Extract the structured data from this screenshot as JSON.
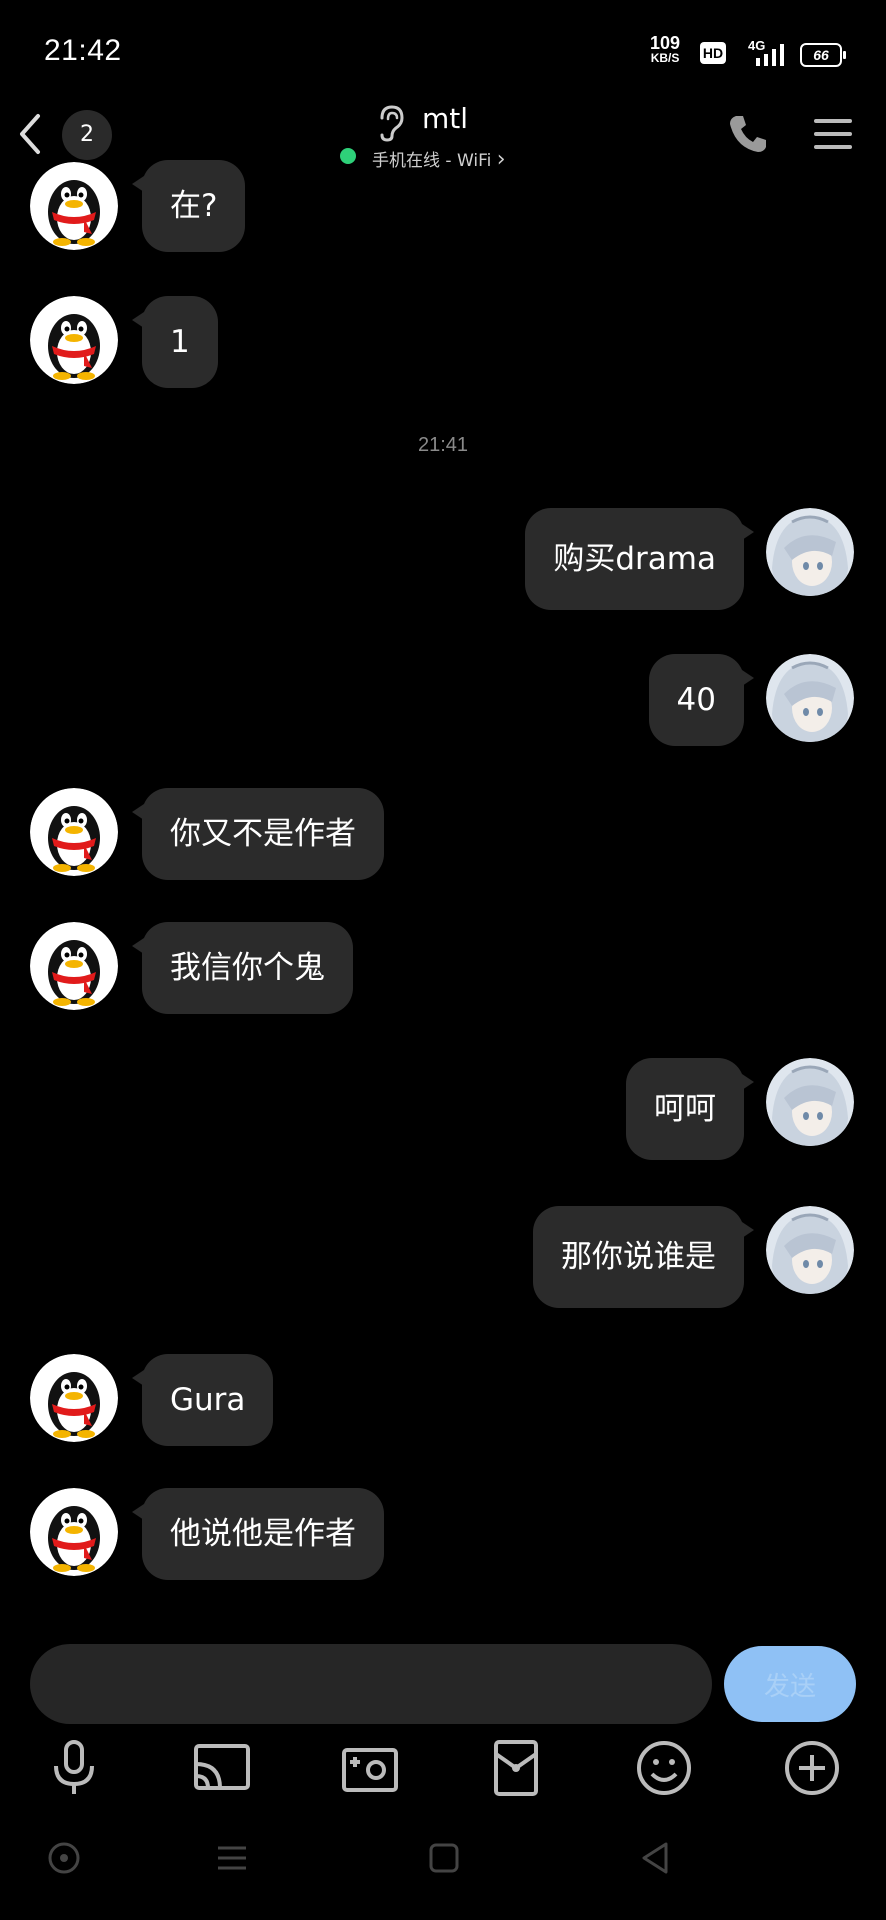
{
  "status_bar": {
    "time": "21:42",
    "net_speed_value": "109",
    "net_speed_unit": "KB/S",
    "hd_label": "HD",
    "net_type": "4G",
    "battery": "66"
  },
  "header": {
    "unread_count": "2",
    "contact_name": "mtl",
    "online_status": "手机在线 - WiFi",
    "chevron": "›"
  },
  "timestamp": "21:41",
  "messages": [
    {
      "side": "left",
      "text": "在?"
    },
    {
      "side": "left",
      "text": "1"
    },
    {
      "side": "right",
      "text": "购买drama"
    },
    {
      "side": "right",
      "text": "40"
    },
    {
      "side": "left",
      "text": "你又不是作者"
    },
    {
      "side": "left",
      "text": "我信你个鬼"
    },
    {
      "side": "right",
      "text": "呵呵"
    },
    {
      "side": "right",
      "text": "那你说谁是"
    },
    {
      "side": "left",
      "text": "Gura"
    },
    {
      "side": "left",
      "text": "他说他是作者"
    }
  ],
  "composer": {
    "placeholder": "",
    "send_label": "发送"
  },
  "toolbar": [
    "mic-icon",
    "cast-icon",
    "camera-icon",
    "red-packet-icon",
    "emoji-icon",
    "plus-icon"
  ],
  "nav": [
    "home-circle-icon",
    "menu-lines-icon",
    "square-icon",
    "back-triangle-icon"
  ],
  "colors": {
    "background": "#000000",
    "bubble": "#2b2b2b",
    "online": "#2ed079",
    "send_button": "#8fc1f5"
  }
}
